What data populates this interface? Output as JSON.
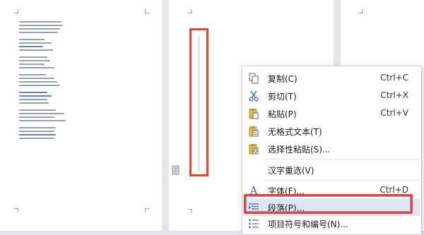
{
  "context_menu": {
    "items": [
      {
        "label": "复制(C)",
        "shortcut": "Ctrl+C",
        "icon": "copy-icon"
      },
      {
        "label": "剪切(T)",
        "shortcut": "Ctrl+X",
        "icon": "scissors-icon"
      },
      {
        "label": "粘贴(P)",
        "shortcut": "Ctrl+V",
        "icon": "paste-icon"
      },
      {
        "label": "无格式文本(T)",
        "shortcut": "",
        "icon": "paste-text-icon"
      },
      {
        "label": "选择性粘贴(S)...",
        "shortcut": "",
        "icon": "paste-special-icon"
      },
      {
        "label": "汉字重选(V)",
        "shortcut": "",
        "icon": ""
      },
      {
        "label": "字体(F)...",
        "shortcut": "Ctrl+D",
        "icon": "font-icon"
      },
      {
        "label": "段落(P)...",
        "shortcut": "",
        "icon": "paragraph-icon",
        "selected": true
      },
      {
        "label": "项目符号和编号(N)...",
        "shortcut": "",
        "icon": "bullet-list-icon"
      }
    ]
  },
  "colors": {
    "highlight_red": "#e8432f",
    "selection_blue": "#dfe6f7",
    "link_blue": "#5f7fd6"
  }
}
